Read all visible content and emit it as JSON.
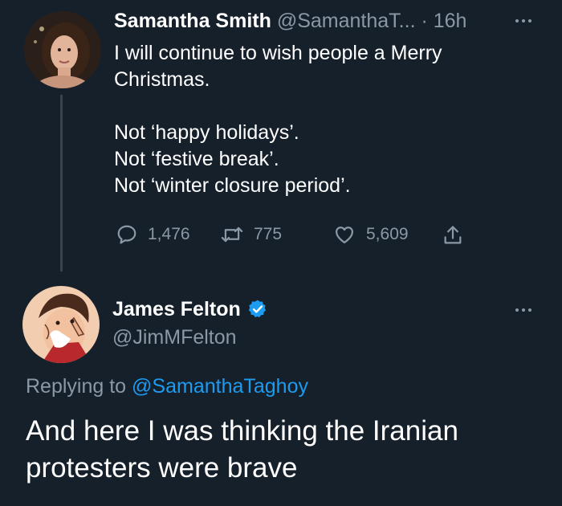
{
  "tweet1": {
    "name": "Samantha Smith",
    "handle": "@SamanthaT...",
    "separator": "·",
    "time": "16h",
    "text": "I will continue to wish people a Merry\nChristmas.\n\nNot ‘happy holidays’.\nNot ‘festive break’.\nNot ‘winter closure period’.",
    "replies": "1,476",
    "retweets": "775",
    "likes": "5,609"
  },
  "tweet2": {
    "name": "James Felton",
    "handle": "@JimMFelton",
    "replying_prefix": "Replying to",
    "replying_handle": "@SamanthaTaghoy",
    "text": "And here I was thinking the Iranian\nprotesters were brave"
  },
  "icons": [
    "more-icon",
    "reply-icon",
    "retweet-icon",
    "like-icon",
    "share-icon",
    "verified-badge-icon"
  ],
  "colors": {
    "background": "#15202b",
    "accent": "#1d9bf0",
    "muted": "#8b98a5",
    "text": "#ffffff"
  }
}
